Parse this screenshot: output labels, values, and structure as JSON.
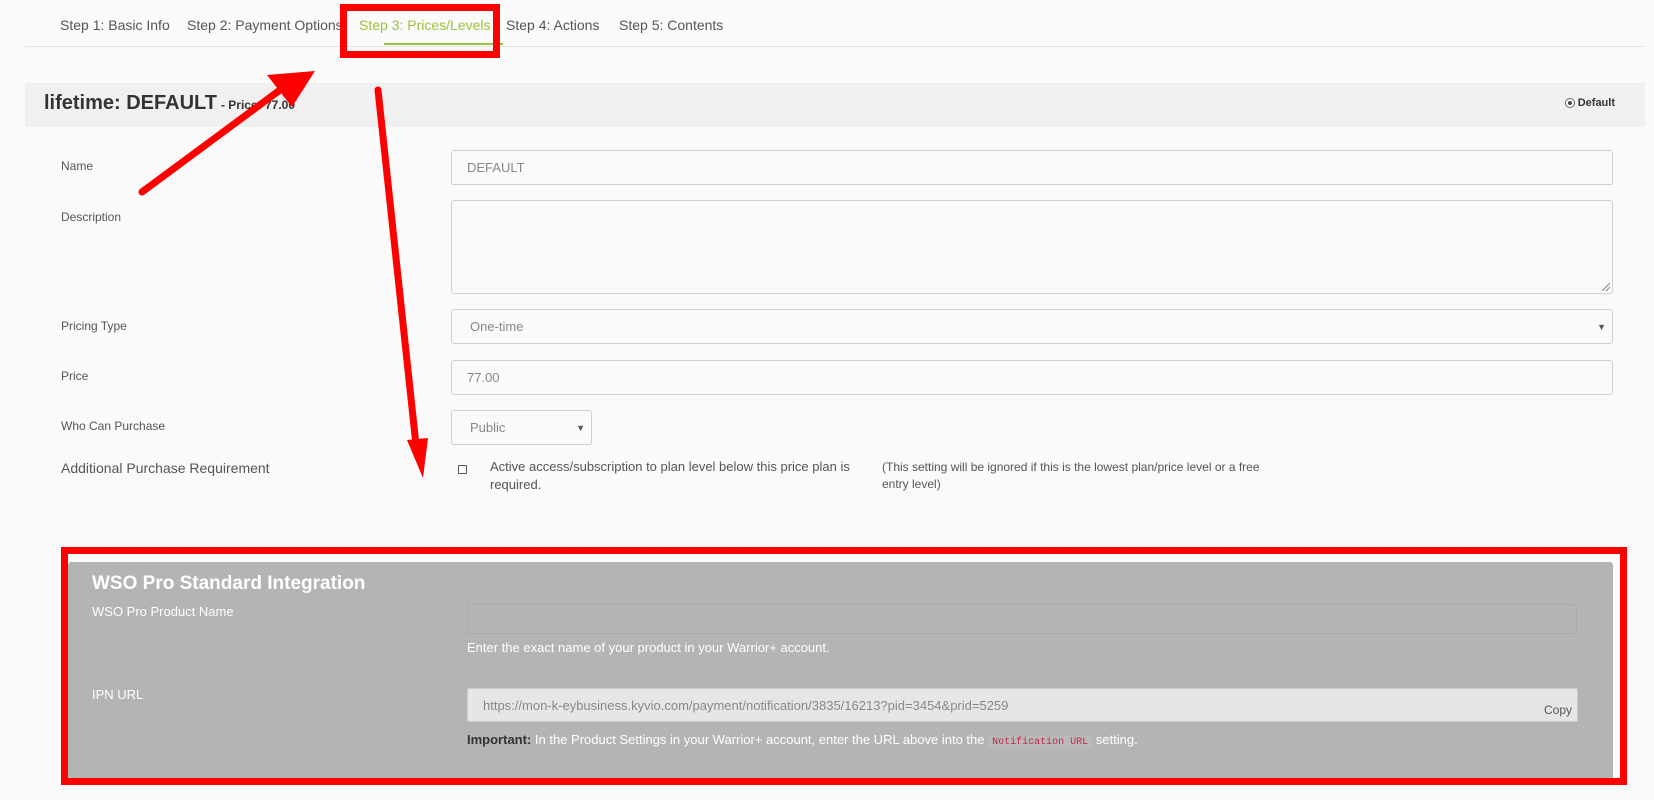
{
  "tabs": [
    {
      "label": "Step 1: Basic Info"
    },
    {
      "label": "Step 2: Payment Options"
    },
    {
      "label": "Step 3: Prices/Levels"
    },
    {
      "label": "Step 4: Actions"
    },
    {
      "label": "Step 5: Contents"
    }
  ],
  "active_tab": "Step 3: Prices/Levels",
  "level": {
    "title": "lifetime: DEFAULT",
    "price_label": "- Price: 77.00",
    "default_label": "Default",
    "default_selected": true
  },
  "form": {
    "name_label": "Name",
    "name_value": "DEFAULT",
    "description_label": "Description",
    "description_value": "",
    "pricing_type_label": "Pricing Type",
    "pricing_type_value": "One-time",
    "price_label": "Price",
    "price_value": "77.00",
    "who_can_purchase_label": "Who Can Purchase",
    "who_can_purchase_value": "Public",
    "additional_req_label": "Additional Purchase Requirement",
    "additional_req_checked": false,
    "additional_req_text": "Active access/subscription to plan level below this price plan is required.",
    "additional_req_note": "(This setting will be ignored if this is the lowest plan/price level or a free entry level)"
  },
  "wso": {
    "title": "WSO Pro Standard Integration",
    "product_name_label": "WSO Pro Product Name",
    "product_name_value": "",
    "product_name_help": "Enter the exact name of your product in your Warrior+ account.",
    "ipn_label": "IPN URL",
    "ipn_value": "https://mon-k-eybusiness.kyvio.com/payment/notification/3835/16213?pid=3454&prid=5259",
    "copy_label": "Copy",
    "important_prefix": "Important:",
    "important_text": "In the Product Settings in your Warrior+ account, enter the URL above into the",
    "important_code": "Notification URL",
    "important_suffix": "setting."
  },
  "colors": {
    "accent": "#9dc23b",
    "annotation": "#ff0000",
    "panel": "#b4b4b4"
  }
}
